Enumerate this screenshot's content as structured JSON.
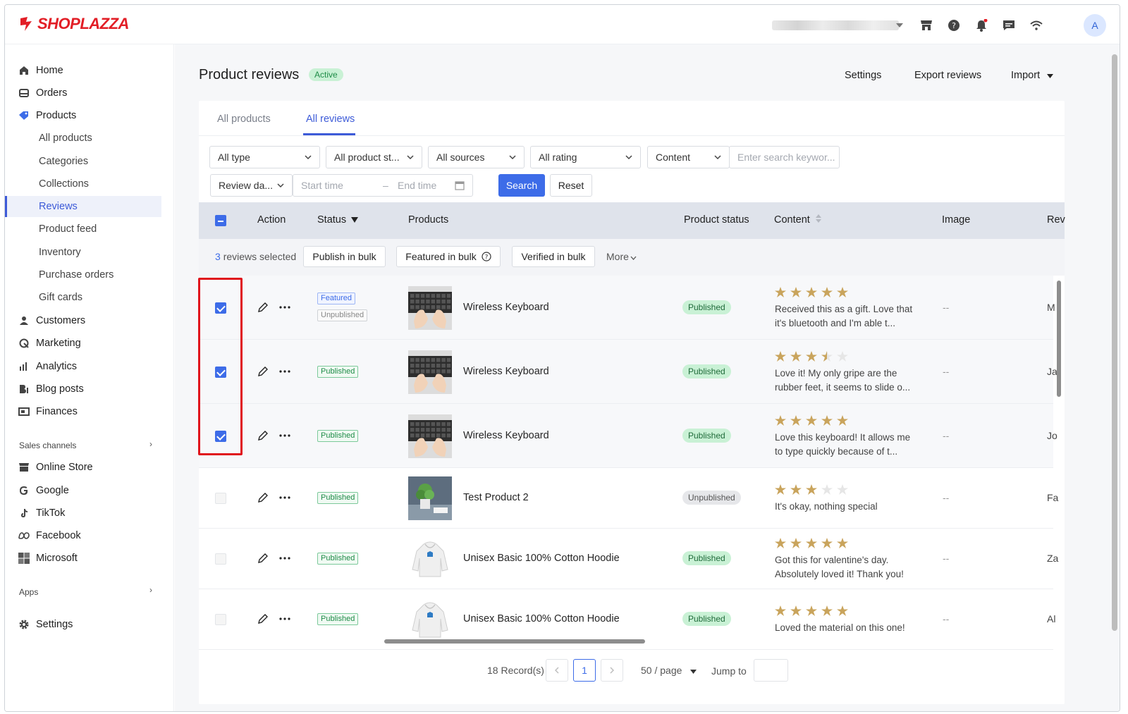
{
  "brand": {
    "logo_text": "SHOPLAZZA",
    "accent": "#3d6ce8",
    "brand_red": "#e21e26"
  },
  "topbar": {
    "avatar_initial": "A",
    "icons": [
      "store-icon",
      "help-icon",
      "bell-icon",
      "message-icon",
      "wifi-icon"
    ]
  },
  "sidebar": {
    "items": [
      {
        "label": "Home",
        "icon": "home-icon"
      },
      {
        "label": "Orders",
        "icon": "orders-icon"
      },
      {
        "label": "Products",
        "icon": "tag-icon"
      },
      {
        "label": "All products"
      },
      {
        "label": "Categories"
      },
      {
        "label": "Collections"
      },
      {
        "label": "Reviews"
      },
      {
        "label": "Product feed"
      },
      {
        "label": "Inventory"
      },
      {
        "label": "Purchase orders"
      },
      {
        "label": "Gift cards"
      },
      {
        "label": "Customers",
        "icon": "person-icon"
      },
      {
        "label": "Marketing",
        "icon": "marketing-icon"
      },
      {
        "label": "Analytics",
        "icon": "analytics-icon"
      },
      {
        "label": "Blog posts",
        "icon": "blog-icon"
      },
      {
        "label": "Finances",
        "icon": "finances-icon"
      }
    ],
    "sales_channels_label": "Sales channels",
    "channels": [
      {
        "label": "Online Store",
        "icon": "store-icon"
      },
      {
        "label": "Google",
        "icon": "google-icon"
      },
      {
        "label": "TikTok",
        "icon": "tiktok-icon"
      },
      {
        "label": "Facebook",
        "icon": "meta-icon"
      },
      {
        "label": "Microsoft",
        "icon": "microsoft-icon"
      }
    ],
    "apps_label": "Apps",
    "settings_label": "Settings"
  },
  "page": {
    "title": "Product reviews",
    "status_badge": "Active",
    "settings_link": "Settings",
    "export_link": "Export reviews",
    "import_link": "Import"
  },
  "tabs": [
    {
      "label": "All products"
    },
    {
      "label": "All reviews"
    }
  ],
  "filters": {
    "type": "All type",
    "product_status": "All product st...",
    "sources": "All sources",
    "rating": "All rating",
    "content": "Content",
    "keyword_placeholder": "Enter search keywor...",
    "review_date": "Review da...",
    "start_placeholder": "Start time",
    "end_placeholder": "End time",
    "search_label": "Search",
    "reset_label": "Reset"
  },
  "table": {
    "headers": {
      "action": "Action",
      "status": "Status",
      "products": "Products",
      "product_status": "Product status",
      "content": "Content",
      "image": "Image",
      "review": "Rev"
    },
    "bulk": {
      "count": "3",
      "selected_text": "reviews selected",
      "publish": "Publish in bulk",
      "featured": "Featured in bulk",
      "verified": "Verified in bulk",
      "more": "More"
    },
    "rows": [
      {
        "checked": true,
        "tags": [
          "Featured",
          "Unpublished"
        ],
        "product": "Wireless Keyboard",
        "product_status": "Published",
        "rating": 5,
        "content": "Received this as a gift. Love that it's bluetooth and I'm able t...",
        "image": "--",
        "reviewer": "M"
      },
      {
        "checked": true,
        "tags": [
          "Published"
        ],
        "product": "Wireless Keyboard",
        "product_status": "Published",
        "rating": 3.5,
        "content": "Love it! My only gripe are the rubber feet, it seems to slide o...",
        "image": "--",
        "reviewer": "Ja"
      },
      {
        "checked": true,
        "tags": [
          "Published"
        ],
        "product": "Wireless Keyboard",
        "product_status": "Published",
        "rating": 5,
        "content": "Love this keyboard! It allows me to type quickly because of t...",
        "image": "--",
        "reviewer": "Jo"
      },
      {
        "checked": false,
        "tags": [
          "Published"
        ],
        "product": "Test Product 2",
        "product_status": "Unpublished",
        "rating": 3,
        "content": "It's okay, nothing special",
        "image": "--",
        "reviewer": "Fa"
      },
      {
        "checked": false,
        "tags": [
          "Published"
        ],
        "product": "Unisex Basic 100% Cotton Hoodie",
        "product_status": "Published",
        "rating": 5,
        "content": "Got this for valentine's day. Absolutely loved it! Thank you!",
        "image": "--",
        "reviewer": "Za"
      },
      {
        "checked": false,
        "tags": [
          "Published"
        ],
        "product": "Unisex Basic 100% Cotton Hoodie",
        "product_status": "Published",
        "rating": 5,
        "content": "Loved the material on this one!",
        "image": "--",
        "reviewer": "Al"
      }
    ]
  },
  "pagination": {
    "records": "18 Record(s)",
    "current_page": "1",
    "per_page": "50 / page",
    "jump_label": "Jump to"
  }
}
